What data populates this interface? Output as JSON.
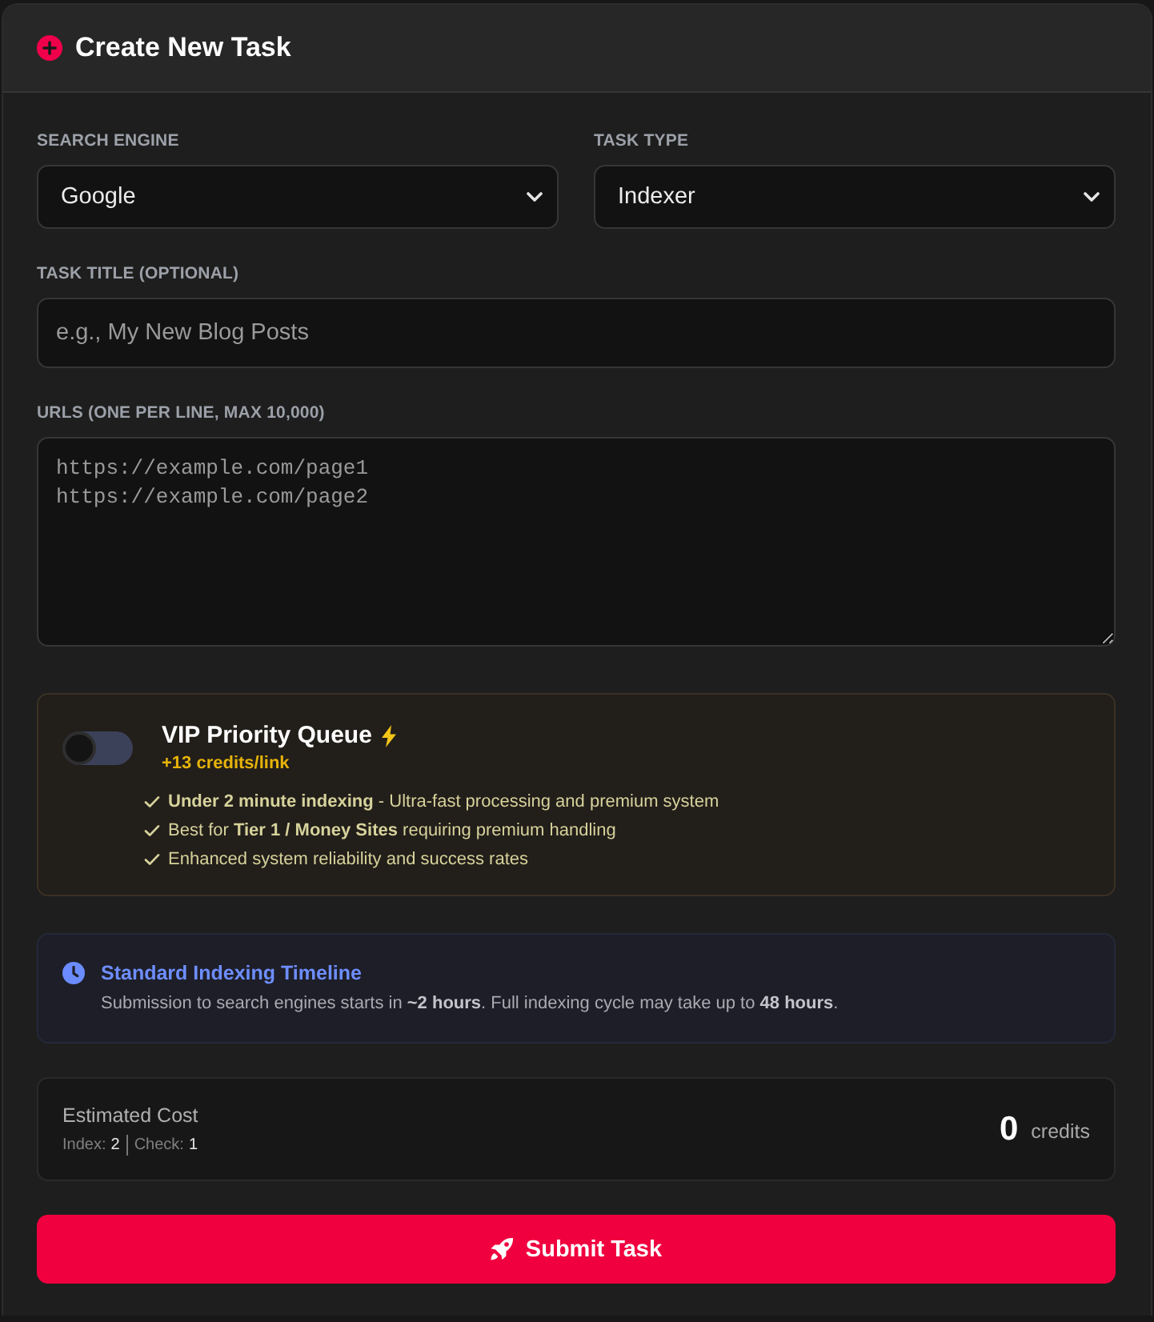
{
  "header": {
    "title": "Create New Task"
  },
  "selects": [
    {
      "label": "SEARCH ENGINE",
      "value": "Google"
    },
    {
      "label": "TASK TYPE",
      "value": "Indexer"
    }
  ],
  "title_field": {
    "label": "TASK TITLE (OPTIONAL)",
    "placeholder": "e.g., My New Blog Posts"
  },
  "urls_field": {
    "label": "URLS (ONE PER LINE, MAX 10,000)",
    "placeholder": "https://example.com/page1\nhttps://example.com/page2"
  },
  "vip": {
    "title": "VIP Priority Queue",
    "on": false,
    "price": "+13 credits/link",
    "features": [
      "**Under 2 minute indexing** - Ultra-fast processing and premium system",
      "Best for **Tier 1 / Money Sites** requiring premium handling",
      "Enhanced system reliability and success rates"
    ]
  },
  "timeline": {
    "title": "Standard Indexing Timeline",
    "text": "Submission to search engines starts in **~2 hours**. Full indexing cycle may take up to **48 hours**."
  },
  "cost": {
    "label": "Estimated Cost",
    "breakdown": [
      {
        "label": "Index:",
        "value": "2"
      },
      {
        "label": "Check:",
        "value": "1"
      }
    ],
    "amount": "0",
    "unit": "credits"
  },
  "submit": {
    "label": "Submit Task"
  }
}
